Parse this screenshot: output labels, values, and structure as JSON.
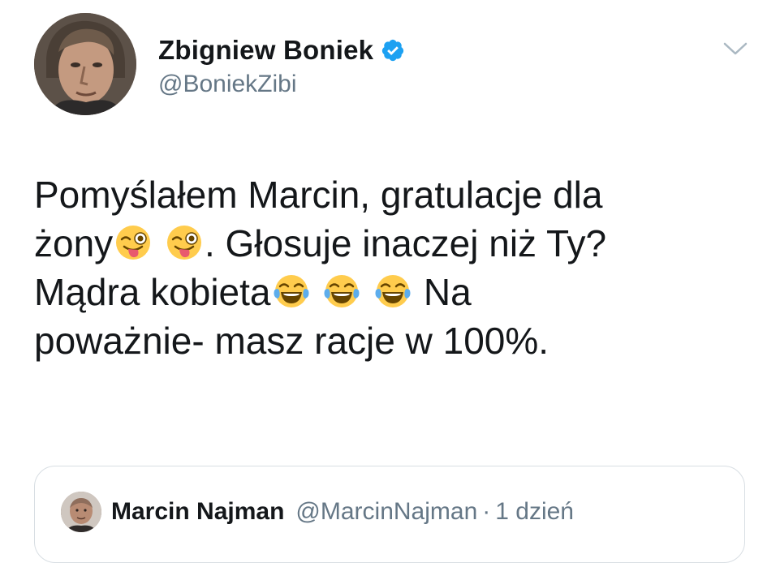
{
  "tweet": {
    "author": {
      "display_name": "Zbigniew Boniek",
      "handle": "@BoniekZibi",
      "verified": true,
      "avatar_icon": "user-photo-avatar"
    },
    "menu_icon": "chevron-down-icon",
    "text_lines": {
      "line1": "Pomyślałem Marcin, gratulacje dla",
      "line2_pre": "żony",
      "line2_post": ". Głosuje inaczej niż Ty?",
      "line3_pre": "Mądra kobieta",
      "line3_post": " Na",
      "line4": "poważnie- masz racje w 100%."
    },
    "emojis": {
      "winking_tongue": "😜",
      "tears_of_joy": "😂"
    }
  },
  "quoted_tweet": {
    "display_name": "Marcin Najman",
    "handle": "@MarcinNajman",
    "separator": "·",
    "time": "1 dzień",
    "avatar_icon": "user-photo-avatar"
  },
  "colors": {
    "text_primary": "#14171a",
    "text_secondary": "#657786",
    "verified_blue": "#1da1f2",
    "border": "#d8dee3"
  }
}
